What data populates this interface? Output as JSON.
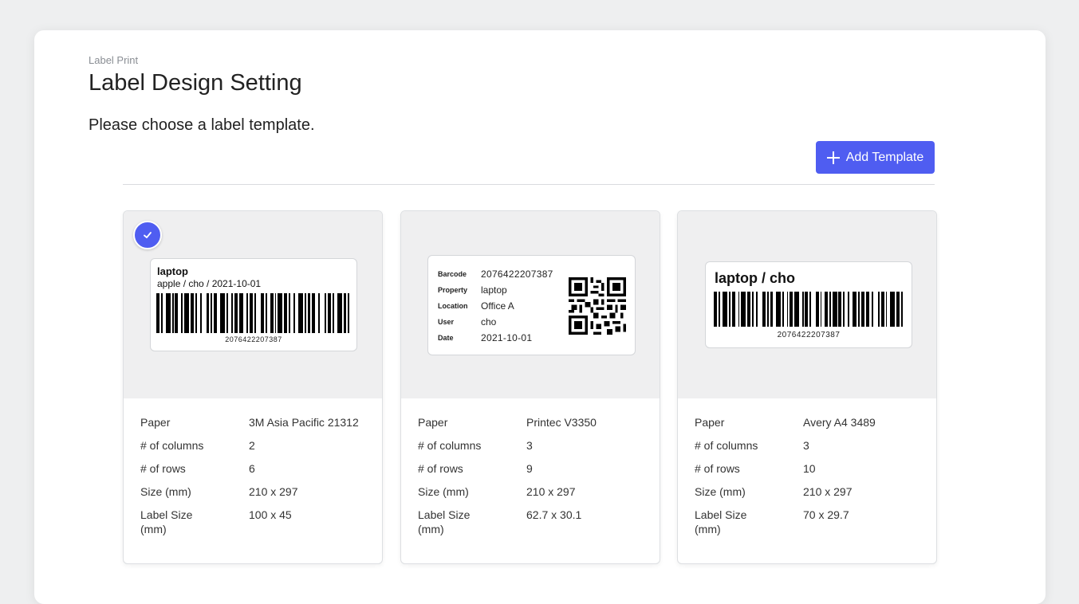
{
  "header": {
    "breadcrumb": "Label Print",
    "title": "Label Design Setting",
    "subtitle": "Please choose a label template.",
    "add_button_label": "Add Template"
  },
  "accent_color": "#4f5df1",
  "templates": [
    {
      "selected": true,
      "preview": {
        "line1": "laptop",
        "line2": "apple / cho / 2021-10-01",
        "barcode_number": "2076422207387"
      },
      "specs": [
        {
          "key": "Paper",
          "value": "3M Asia Pacific 21312"
        },
        {
          "key": "# of columns",
          "value": "2"
        },
        {
          "key": "# of rows",
          "value": "6"
        },
        {
          "key": "Size (mm)",
          "value": "210 x 297"
        },
        {
          "key": "Label Size (mm)",
          "value": "100 x 45"
        }
      ]
    },
    {
      "selected": false,
      "preview": {
        "fields": [
          {
            "key": "Barcode",
            "value": "2076422207387"
          },
          {
            "key": "Property",
            "value": "laptop"
          },
          {
            "key": "Location",
            "value": "Office A"
          },
          {
            "key": "User",
            "value": "cho"
          },
          {
            "key": "Date",
            "value": "2021-10-01"
          }
        ]
      },
      "specs": [
        {
          "key": "Paper",
          "value": "Printec V3350"
        },
        {
          "key": "# of columns",
          "value": "3"
        },
        {
          "key": "# of rows",
          "value": "9"
        },
        {
          "key": "Size (mm)",
          "value": "210 x 297"
        },
        {
          "key": "Label Size (mm)",
          "value": "62.7 x 30.1"
        }
      ]
    },
    {
      "selected": false,
      "preview": {
        "line1": "laptop / cho",
        "barcode_number": "2076422207387"
      },
      "specs": [
        {
          "key": "Paper",
          "value": "Avery A4 3489"
        },
        {
          "key": "# of columns",
          "value": "3"
        },
        {
          "key": "# of rows",
          "value": "10"
        },
        {
          "key": "Size (mm)",
          "value": "210 x 297"
        },
        {
          "key": "Label Size (mm)",
          "value": "70 x 29.7"
        }
      ]
    }
  ]
}
